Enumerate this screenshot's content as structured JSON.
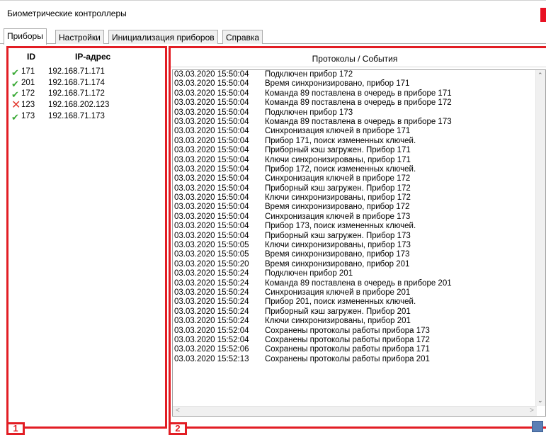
{
  "window": {
    "title": "Биометрические контроллеры"
  },
  "tabs": [
    "Приборы",
    "Настройки",
    "Инициализация приборов",
    "Справка"
  ],
  "devices": {
    "header_id": "ID",
    "header_ip": "IP-адрес",
    "rows": [
      {
        "status": "ok",
        "id": "171",
        "ip": "192.168.71.171"
      },
      {
        "status": "ok",
        "id": "201",
        "ip": "192.168.71.174"
      },
      {
        "status": "ok",
        "id": "172",
        "ip": "192.168.71.172"
      },
      {
        "status": "error",
        "id": "123",
        "ip": "192.168.202.123"
      },
      {
        "status": "ok",
        "id": "173",
        "ip": "192.168.71.173"
      }
    ]
  },
  "events": {
    "title": "Протоколы / События",
    "rows": [
      {
        "time": "03.03.2020 15:50:04",
        "text": "Подключен прибор 172"
      },
      {
        "time": "03.03.2020 15:50:04",
        "text": "Время синхронизировано, прибор 171"
      },
      {
        "time": "03.03.2020 15:50:04",
        "text": "Команда 89 поставлена в очередь в приборе 171"
      },
      {
        "time": "03.03.2020 15:50:04",
        "text": "Команда 89 поставлена в очередь в приборе 172"
      },
      {
        "time": "03.03.2020 15:50:04",
        "text": "Подключен прибор 173"
      },
      {
        "time": "03.03.2020 15:50:04",
        "text": "Команда 89 поставлена в очередь в приборе 173"
      },
      {
        "time": "03.03.2020 15:50:04",
        "text": "Синхронизация ключей в приборе 171"
      },
      {
        "time": "03.03.2020 15:50:04",
        "text": "Прибор 171, поиск измененных ключей."
      },
      {
        "time": "03.03.2020 15:50:04",
        "text": "Приборный кэш загружен. Прибор 171"
      },
      {
        "time": "03.03.2020 15:50:04",
        "text": "Ключи синхронизированы, прибор 171"
      },
      {
        "time": "03.03.2020 15:50:04",
        "text": "Прибор 172, поиск измененных ключей."
      },
      {
        "time": "03.03.2020 15:50:04",
        "text": "Синхронизация ключей в приборе 172"
      },
      {
        "time": "03.03.2020 15:50:04",
        "text": "Приборный кэш загружен. Прибор 172"
      },
      {
        "time": "03.03.2020 15:50:04",
        "text": "Ключи синхронизированы, прибор 172"
      },
      {
        "time": "03.03.2020 15:50:04",
        "text": "Время синхронизировано, прибор 172"
      },
      {
        "time": "03.03.2020 15:50:04",
        "text": "Синхронизация ключей в приборе 173"
      },
      {
        "time": "03.03.2020 15:50:04",
        "text": "Прибор 173, поиск измененных ключей."
      },
      {
        "time": "03.03.2020 15:50:04",
        "text": "Приборный кэш загружен. Прибор 173"
      },
      {
        "time": "03.03.2020 15:50:05",
        "text": "Ключи синхронизированы, прибор 173"
      },
      {
        "time": "03.03.2020 15:50:05",
        "text": "Время синхронизировано, прибор 173"
      },
      {
        "time": "03.03.2020 15:50:20",
        "text": "Время синхронизировано, прибор 201"
      },
      {
        "time": "03.03.2020 15:50:24",
        "text": "Подключен прибор 201"
      },
      {
        "time": "03.03.2020 15:50:24",
        "text": "Команда 89 поставлена в очередь в приборе 201"
      },
      {
        "time": "03.03.2020 15:50:24",
        "text": "Синхронизация ключей в приборе 201"
      },
      {
        "time": "03.03.2020 15:50:24",
        "text": "Прибор 201, поиск измененных ключей."
      },
      {
        "time": "03.03.2020 15:50:24",
        "text": "Приборный кэш загружен. Прибор 201"
      },
      {
        "time": "03.03.2020 15:50:24",
        "text": "Ключи синхронизированы, прибор 201"
      },
      {
        "time": "03.03.2020 15:52:04",
        "text": "Сохранены протоколы работы прибора 173"
      },
      {
        "time": "03.03.2020 15:52:04",
        "text": "Сохранены протоколы работы прибора 172"
      },
      {
        "time": "03.03.2020 15:52:06",
        "text": "Сохранены протоколы работы прибора 171"
      },
      {
        "time": "03.03.2020 15:52:13",
        "text": "Сохранены протоколы работы прибора 201"
      }
    ]
  },
  "markers": [
    "1",
    "2"
  ],
  "icons": {
    "ok": "check-icon",
    "error": "cross-icon",
    "edit": "edit-icon"
  },
  "colors": {
    "highlight_red": "#e21d24",
    "ok_green": "#39a935",
    "error_red": "#e2392f",
    "close_red": "#e81123"
  }
}
